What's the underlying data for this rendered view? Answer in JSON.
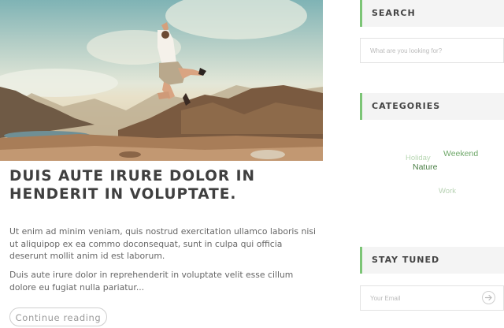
{
  "post": {
    "image_alt": "Person jumping on a mountain top",
    "title": "DUIS AUTE IRURE DOLOR IN HENDERIT IN VOLUPTATE.",
    "paragraphs": [
      "Ut enim ad minim veniam, quis nostrud exercitation ullamco laboris nisi ut aliquipop ex ea commo doconsequat, sunt in culpa qui officia deserunt mollit anim id est laborum.",
      "Duis aute irure dolor in reprehenderit in voluptate velit esse cillum dolore eu fugiat nulla pariatur..."
    ],
    "continue_label": "Continue reading"
  },
  "sidebar": {
    "search": {
      "title": "SEARCH",
      "placeholder": "What are you looking for?"
    },
    "categories": {
      "title": "CATEGORIES",
      "tags": [
        "Holiday",
        "Weekend",
        "Nature",
        "Work"
      ]
    },
    "stay_tuned": {
      "title": "STAY TUNED",
      "email_placeholder": "Your Email",
      "submit_icon": "arrow-right-circle-icon"
    }
  },
  "colors": {
    "accent": "#7cc576",
    "title_text": "#3f3f3f",
    "body_text": "#666666",
    "widget_bg": "#f4f4f4"
  }
}
